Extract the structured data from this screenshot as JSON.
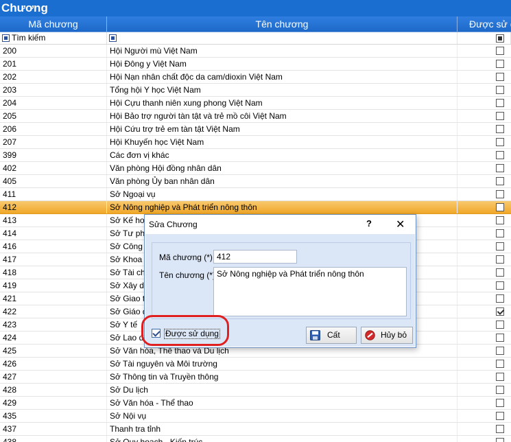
{
  "window": {
    "title": "Chương"
  },
  "grid": {
    "columns": {
      "code": "Mã chương",
      "name": "Tên chương",
      "used": "Được sử dụng"
    },
    "filter": {
      "search_label": "Tìm kiếm"
    },
    "rows": [
      {
        "code": "200",
        "name": "Hội Người mù Việt Nam",
        "used": false
      },
      {
        "code": "201",
        "name": "Hội Đông y Việt Nam",
        "used": false
      },
      {
        "code": "202",
        "name": "Hội Nạn nhân chất độc da cam/dioxin Việt Nam",
        "used": false
      },
      {
        "code": "203",
        "name": "Tổng hội Y học Việt Nam",
        "used": false
      },
      {
        "code": "204",
        "name": "Hội Cựu thanh niên xung phong Việt Nam",
        "used": false
      },
      {
        "code": "205",
        "name": "Hội Bảo trợ người tàn tật và trẻ mồ côi Việt Nam",
        "used": false
      },
      {
        "code": "206",
        "name": "Hội Cứu trợ trẻ em tàn tật Việt Nam",
        "used": false
      },
      {
        "code": "207",
        "name": "Hội Khuyến học Việt Nam",
        "used": false
      },
      {
        "code": "399",
        "name": "Các đơn vị khác",
        "used": false
      },
      {
        "code": "402",
        "name": "Văn phòng Hội đồng nhân dân",
        "used": false
      },
      {
        "code": "405",
        "name": "Văn phòng Ủy ban nhân dân",
        "used": false
      },
      {
        "code": "411",
        "name": "Sở Ngoại vụ",
        "used": false
      },
      {
        "code": "412",
        "name": "Sở Nông nghiệp và Phát triển nông thôn",
        "used": false,
        "selected": true
      },
      {
        "code": "413",
        "name": "Sở Kế hoạ",
        "used": false
      },
      {
        "code": "414",
        "name": "Sở Tư phá",
        "used": false
      },
      {
        "code": "416",
        "name": "Sở Công T",
        "used": false
      },
      {
        "code": "417",
        "name": "Sở Khoa h",
        "used": false
      },
      {
        "code": "418",
        "name": "Sở Tài chí",
        "used": false
      },
      {
        "code": "419",
        "name": "Sở Xây dự",
        "used": false
      },
      {
        "code": "421",
        "name": "Sở Giao th",
        "used": false
      },
      {
        "code": "422",
        "name": "Sở Giáo dụ",
        "used": true
      },
      {
        "code": "423",
        "name": "Sở Y tế",
        "used": false
      },
      {
        "code": "424",
        "name": "Sở Lao độ",
        "used": false
      },
      {
        "code": "425",
        "name": "Sở Văn hóa, Thể thao và Du lịch",
        "used": false
      },
      {
        "code": "426",
        "name": "Sở Tài nguyên và Môi trường",
        "used": false
      },
      {
        "code": "427",
        "name": "Sở Thông tin và Truyền thông",
        "used": false
      },
      {
        "code": "428",
        "name": "Sở Du lịch",
        "used": false
      },
      {
        "code": "429",
        "name": "Sở Văn hóa - Thể thao",
        "used": false
      },
      {
        "code": "435",
        "name": "Sở Nội vụ",
        "used": false
      },
      {
        "code": "437",
        "name": "Thanh tra tỉnh",
        "used": false
      },
      {
        "code": "438",
        "name": "Sở Quy hoạch - Kiến trúc",
        "used": false
      }
    ]
  },
  "dialog": {
    "title": "Sửa Chương",
    "help": "?",
    "close": "✕",
    "code_label": "Mã chương (*)",
    "code_value": "412",
    "name_label": "Tên chương (*)",
    "name_value": "Sở Nông nghiệp và Phát triển nông thôn",
    "used_label": "Được sử dụng",
    "used_checked": true,
    "save_label": "Cất",
    "cancel_label": "Hủy bỏ"
  },
  "colors": {
    "title_bar": "#1a6ed0",
    "header": "#2f7fe0",
    "selected_row": "#f0a728",
    "dialog_body": "#dbe6f6",
    "highlight": "#e02020"
  }
}
